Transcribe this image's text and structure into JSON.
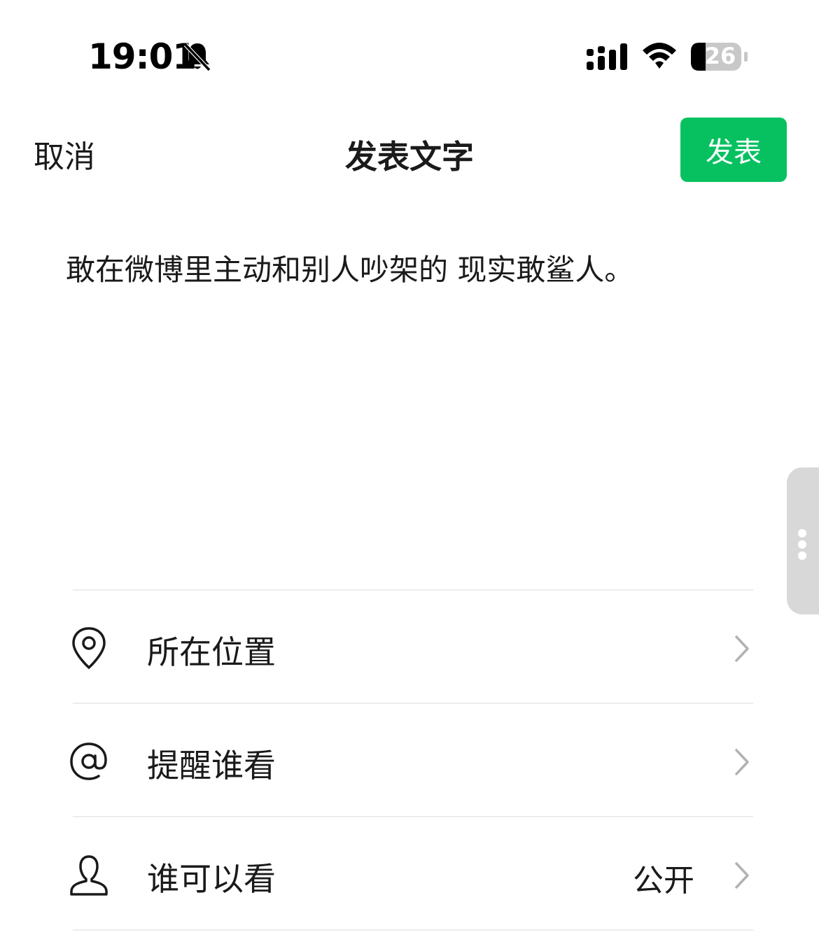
{
  "status_bar": {
    "time": "19:01",
    "battery_level": "26",
    "icons": [
      "bell-muted-icon",
      "signal-icon",
      "wifi-icon",
      "battery-icon"
    ]
  },
  "nav": {
    "cancel_label": "取消",
    "title": "发表文字",
    "publish_label": "发表"
  },
  "post": {
    "text": "敢在微博里主动和别人吵架的 现实敢鲨人。"
  },
  "menu": {
    "items": [
      {
        "label": "所在位置",
        "value": "",
        "icon": "location-pin-icon"
      },
      {
        "label": "提醒谁看",
        "value": "",
        "icon": "at-sign-icon"
      },
      {
        "label": "谁可以看",
        "value": "公开",
        "icon": "person-icon"
      }
    ]
  },
  "colors": {
    "accent": "#07c160",
    "text": "#1a1a1a",
    "divider": "#ececec",
    "chevron": "#b2b2b2"
  }
}
